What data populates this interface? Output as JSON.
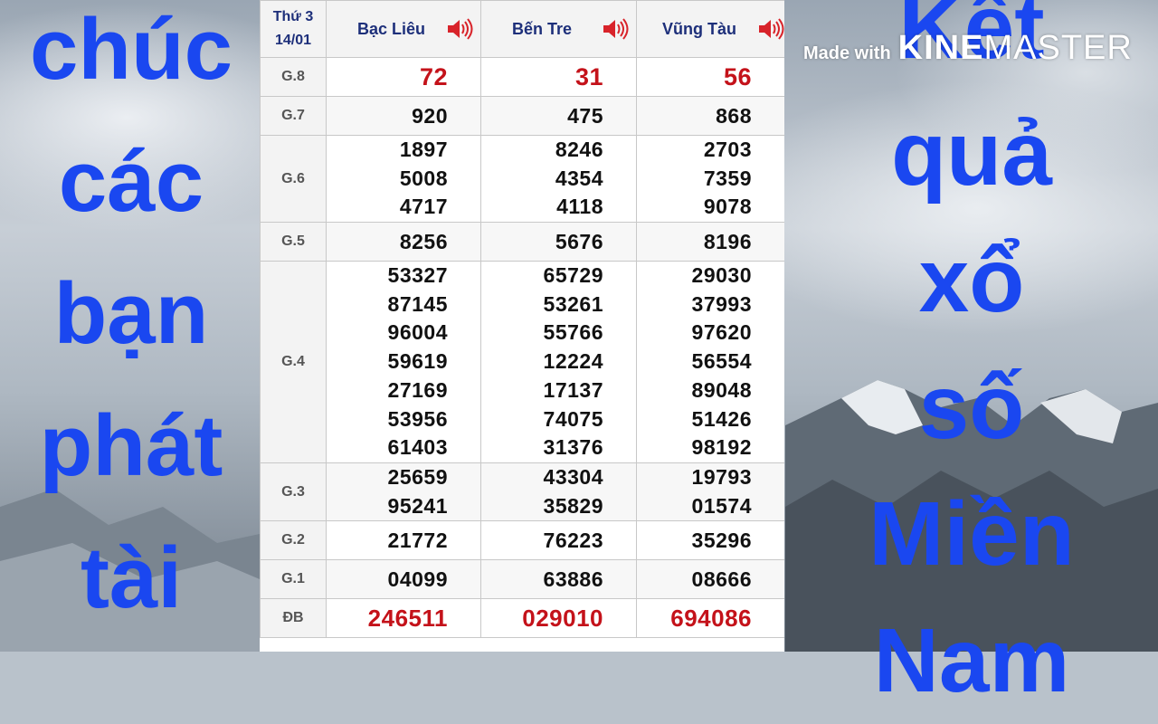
{
  "left_banner": {
    "lines": [
      "chúc",
      "các",
      "bạn",
      "phát",
      "tài"
    ]
  },
  "right_banner": {
    "lines": [
      "Kết",
      "quả",
      "xổ",
      "số",
      "Miền",
      "Nam"
    ]
  },
  "watermark": {
    "made_with": "Made with",
    "brand_a": "KINE",
    "brand_b": "MASTER"
  },
  "table": {
    "date_line1": "Thứ 3",
    "date_line2": "14/01",
    "provinces": [
      "Bạc Liêu",
      "Bến Tre",
      "Vũng Tàu"
    ],
    "speaker_icon": "speaker-icon",
    "prizes": {
      "g8": {
        "label": "G.8",
        "values": [
          "72",
          "31",
          "56"
        ]
      },
      "g7": {
        "label": "G.7",
        "values": [
          "920",
          "475",
          "868"
        ]
      },
      "g6": {
        "label": "G.6",
        "values": [
          [
            "1897",
            "5008",
            "4717"
          ],
          [
            "8246",
            "4354",
            "4118"
          ],
          [
            "2703",
            "7359",
            "9078"
          ]
        ]
      },
      "g5": {
        "label": "G.5",
        "values": [
          "8256",
          "5676",
          "8196"
        ]
      },
      "g4": {
        "label": "G.4",
        "values": [
          [
            "53327",
            "87145",
            "96004",
            "59619",
            "27169",
            "53956",
            "61403"
          ],
          [
            "65729",
            "53261",
            "55766",
            "12224",
            "17137",
            "74075",
            "31376"
          ],
          [
            "29030",
            "37993",
            "97620",
            "56554",
            "89048",
            "51426",
            "98192"
          ]
        ]
      },
      "g3": {
        "label": "G.3",
        "values": [
          [
            "25659",
            "95241"
          ],
          [
            "43304",
            "35829"
          ],
          [
            "19793",
            "01574"
          ]
        ]
      },
      "g2": {
        "label": "G.2",
        "values": [
          "21772",
          "76223",
          "35296"
        ]
      },
      "g1": {
        "label": "G.1",
        "values": [
          "04099",
          "63886",
          "08666"
        ]
      },
      "db": {
        "label": "ĐB",
        "values": [
          "246511",
          "029010",
          "694086"
        ]
      }
    }
  },
  "colors": {
    "banner_text": "#1a47f0",
    "highlight_number": "#c4121a",
    "header_text": "#1d2f7a"
  }
}
